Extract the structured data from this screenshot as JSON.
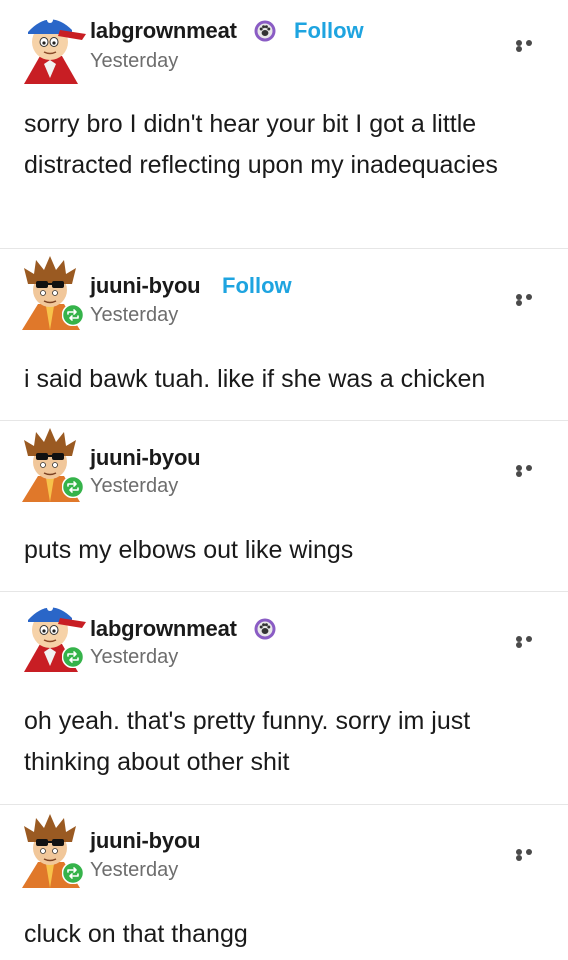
{
  "posts": [
    {
      "username": "labgrownmeat",
      "has_badge": true,
      "follow_label": "Follow",
      "time": "Yesterday",
      "text": "sorry bro I didn't hear your bit I got a little distracted reflecting upon my inadequacies",
      "avatar": "red-cap-character-avatar"
    },
    {
      "username": "juuni-byou",
      "has_badge": false,
      "follow_label": "Follow",
      "time": "Yesterday",
      "text": "i said bawk tuah. like if she was a chicken",
      "avatar": "sunglasses-character-avatar"
    },
    {
      "username": "juuni-byou",
      "has_badge": false,
      "time": "Yesterday",
      "text": "puts my elbows out like wings",
      "avatar": "sunglasses-character-avatar"
    },
    {
      "username": "labgrownmeat",
      "has_badge": true,
      "time": "Yesterday",
      "text": "oh yeah. that's pretty funny. sorry im just thinking about other shit",
      "avatar": "red-cap-character-avatar"
    },
    {
      "username": "juuni-byou",
      "has_badge": false,
      "time": "Yesterday",
      "text": "cluck on that thangg",
      "avatar": "sunglasses-character-avatar"
    }
  ],
  "icons": {
    "more": "more-options-icon",
    "reblog": "reblog-icon",
    "badge": "paw-badge-icon"
  },
  "colors": {
    "follow": "#1ea4e0",
    "reblog_badge": "#35b34a",
    "badge_purple": "#8a5cc4"
  }
}
